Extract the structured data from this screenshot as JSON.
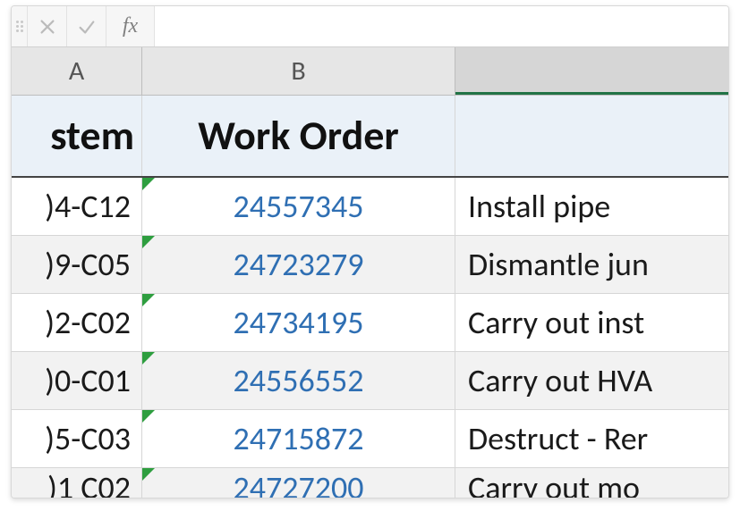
{
  "formula_bar": {
    "fx_label": "fx",
    "value": ""
  },
  "columns": {
    "A": "A",
    "B": "B",
    "C": ""
  },
  "headers": {
    "system": "stem",
    "work_order": "Work Order",
    "desc": ""
  },
  "rows": [
    {
      "system": ")4-C12",
      "work_order": "24557345",
      "desc": "Install pipe"
    },
    {
      "system": ")9-C05",
      "work_order": "24723279",
      "desc": "Dismantle jun"
    },
    {
      "system": ")2-C02",
      "work_order": "24734195",
      "desc": "Carry out inst"
    },
    {
      "system": ")0-C01",
      "work_order": "24556552",
      "desc": "Carry out HVA"
    },
    {
      "system": ")5-C03",
      "work_order": "24715872",
      "desc": "Destruct - Rer"
    },
    {
      "system": ")1  C02",
      "work_order": "24727200",
      "desc": "Carry out mo"
    }
  ]
}
